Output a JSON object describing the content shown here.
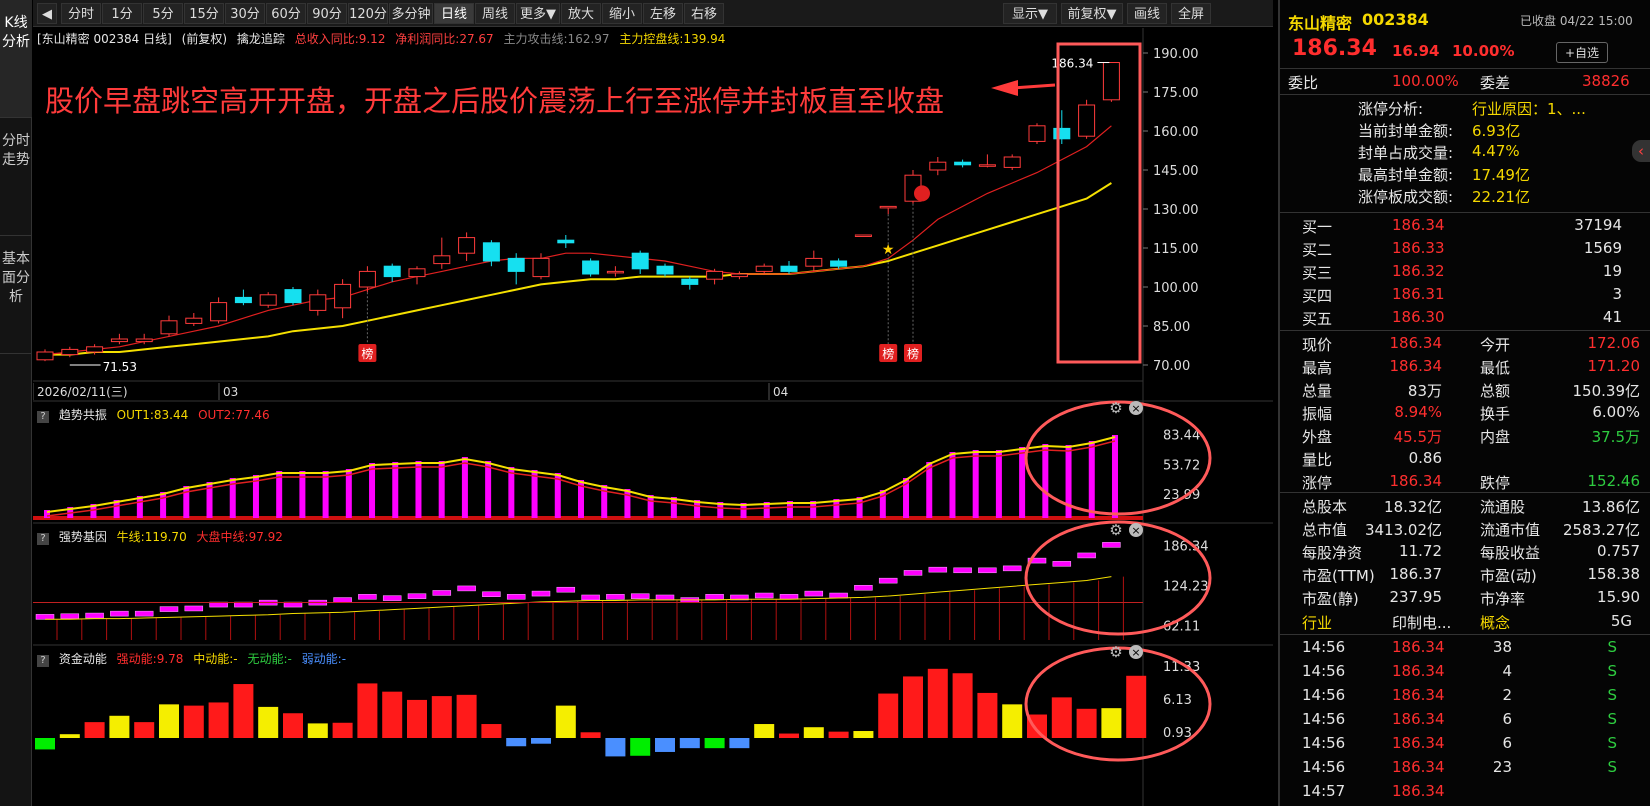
{
  "toolbar": {
    "back_icon": "collapse-left-icon",
    "buttons": [
      "分时",
      "1分",
      "5分",
      "15分",
      "30分",
      "60分",
      "90分",
      "120分",
      "多分钟",
      "日线",
      "周线",
      "更多▼",
      "放大",
      "缩小",
      "左移",
      "右移"
    ],
    "active": "日线",
    "right_buttons": [
      "显示▼",
      "前复权▼",
      "画线",
      "全屏"
    ]
  },
  "leftbar": {
    "tabs": [
      "K线分析",
      "分时走势",
      "基本面分析"
    ],
    "active": 0
  },
  "main": {
    "info": {
      "stock": "[东山精密 002384 日线]",
      "adj": "(前复权)",
      "indicator": "擒龙追踪",
      "rev": "总收入同比:9.12",
      "profit": "净利润同比:27.67",
      "attack": "主力攻击线:162.97",
      "control": "主力控盘线:139.94"
    },
    "annotation": "股价早盘跳空高开开盘，开盘之后股价震荡上行至涨停并封板直至收盘",
    "price_axis": [
      "190.00",
      "175.00",
      "160.00",
      "145.00",
      "130.00",
      "115.00",
      "100.00",
      "85.00",
      "70.00"
    ],
    "dates": [
      "2026/02/11(三)",
      "03",
      "04"
    ],
    "high_label": "186.34",
    "low_label": "71.53",
    "badge": "榜",
    "panel1": {
      "name": "趋势共振",
      "out1": "OUT1:83.44",
      "out2": "OUT2:77.46",
      "axis": [
        "83.44",
        "53.72",
        "23.99"
      ]
    },
    "panel2": {
      "name": "强势基因",
      "bull": "牛线:119.70",
      "mid": "大盘中线:97.92",
      "axis": [
        "186.34",
        "124.23",
        "62.11"
      ]
    },
    "panel3": {
      "name": "资金动能",
      "strong": "强动能:9.78",
      "medium": "中动能:-",
      "none": "无动能:-",
      "weak": "弱动能:-",
      "axis": [
        "11.33",
        "6.13",
        "0.93"
      ]
    }
  },
  "chart_data": {
    "type": "candlestick",
    "title": "",
    "ylim": [
      65,
      195
    ],
    "candles": [
      {
        "o": 72,
        "c": 75,
        "h": 76,
        "l": 71.5
      },
      {
        "o": 74,
        "c": 76,
        "h": 77,
        "l": 73
      },
      {
        "o": 75,
        "c": 77,
        "h": 78,
        "l": 74
      },
      {
        "o": 79,
        "c": 80,
        "h": 82,
        "l": 78
      },
      {
        "o": 79,
        "c": 80,
        "h": 82,
        "l": 78
      },
      {
        "o": 82,
        "c": 87,
        "h": 89,
        "l": 81
      },
      {
        "o": 86,
        "c": 88,
        "h": 90,
        "l": 85
      },
      {
        "o": 87,
        "c": 94,
        "h": 96,
        "l": 86
      },
      {
        "o": 96,
        "c": 94,
        "h": 99,
        "l": 93
      },
      {
        "o": 93,
        "c": 97,
        "h": 98,
        "l": 92
      },
      {
        "o": 99,
        "c": 94,
        "h": 100,
        "l": 93
      },
      {
        "o": 91,
        "c": 97,
        "h": 99,
        "l": 89
      },
      {
        "o": 92,
        "c": 101,
        "h": 103,
        "l": 88
      },
      {
        "o": 100,
        "c": 106,
        "h": 108,
        "l": 98
      },
      {
        "o": 108,
        "c": 104,
        "h": 109,
        "l": 102
      },
      {
        "o": 104,
        "c": 107,
        "h": 108,
        "l": 101
      },
      {
        "o": 109,
        "c": 112,
        "h": 119,
        "l": 107
      },
      {
        "o": 113,
        "c": 119,
        "h": 121,
        "l": 110
      },
      {
        "o": 117,
        "c": 110,
        "h": 118,
        "l": 108
      },
      {
        "o": 111,
        "c": 106,
        "h": 113,
        "l": 101
      },
      {
        "o": 104,
        "c": 111,
        "h": 113,
        "l": 103
      },
      {
        "o": 118,
        "c": 117,
        "h": 120,
        "l": 115
      },
      {
        "o": 110,
        "c": 105,
        "h": 111,
        "l": 104
      },
      {
        "o": 106,
        "c": 106,
        "h": 108,
        "l": 104
      },
      {
        "o": 113,
        "c": 107,
        "h": 114,
        "l": 105
      },
      {
        "o": 108,
        "c": 105,
        "h": 109,
        "l": 104
      },
      {
        "o": 103,
        "c": 101,
        "h": 104,
        "l": 99
      },
      {
        "o": 103,
        "c": 106,
        "h": 107,
        "l": 101
      },
      {
        "o": 104,
        "c": 105,
        "h": 106,
        "l": 103
      },
      {
        "o": 106,
        "c": 108,
        "h": 109,
        "l": 105
      },
      {
        "o": 108,
        "c": 106,
        "h": 110,
        "l": 105
      },
      {
        "o": 108,
        "c": 111,
        "h": 114,
        "l": 106
      },
      {
        "o": 110,
        "c": 108,
        "h": 111,
        "l": 107
      },
      {
        "o": 120,
        "c": 120,
        "h": 120,
        "l": 120
      },
      {
        "o": 131,
        "c": 131,
        "h": 131,
        "l": 128
      },
      {
        "o": 133,
        "c": 143,
        "h": 145,
        "l": 132
      },
      {
        "o": 145,
        "c": 148,
        "h": 150,
        "l": 143
      },
      {
        "o": 148,
        "c": 147,
        "h": 149,
        "l": 146
      },
      {
        "o": 147,
        "c": 147,
        "h": 151,
        "l": 146
      },
      {
        "o": 146,
        "c": 150,
        "h": 151,
        "l": 145
      },
      {
        "o": 156,
        "c": 162,
        "h": 163,
        "l": 155
      },
      {
        "o": 161,
        "c": 157,
        "h": 168,
        "l": 155
      },
      {
        "o": 158,
        "c": 170,
        "h": 172,
        "l": 157
      },
      {
        "o": 172,
        "c": 186.34,
        "h": 186.34,
        "l": 171.2
      }
    ],
    "ma_red": [
      74,
      75,
      76,
      77,
      79,
      81,
      83,
      85,
      88,
      91,
      93,
      95,
      96,
      99,
      102,
      104,
      106,
      108,
      110,
      111,
      111,
      113,
      113,
      112,
      111,
      110,
      108,
      106,
      105,
      105,
      105,
      106,
      107,
      108,
      111,
      118,
      126,
      131,
      136,
      140,
      144,
      149,
      154,
      162
    ],
    "ma_yellow": [
      74,
      74,
      75,
      75,
      76,
      77,
      78,
      79,
      80,
      81,
      83,
      84,
      85,
      87,
      89,
      91,
      93,
      95,
      97,
      99,
      101,
      102,
      103,
      103,
      104,
      104,
      104,
      104,
      105,
      105,
      105,
      106,
      107,
      108,
      110,
      113,
      116,
      119,
      122,
      125,
      128,
      131,
      134,
      140
    ],
    "panel1_bars": [
      8,
      11,
      14,
      18,
      22,
      26,
      32,
      36,
      40,
      43,
      47,
      47,
      47,
      49,
      55,
      56,
      57,
      57,
      61,
      57,
      51,
      48,
      45,
      38,
      33,
      29,
      23,
      21,
      18,
      16,
      15,
      16,
      17,
      17,
      19,
      21,
      28,
      40,
      56,
      66,
      68,
      68,
      71,
      74,
      73,
      77,
      83
    ],
    "panel3_bars": [
      -1.8,
      0.6,
      2.5,
      3.5,
      2.5,
      5.3,
      5.1,
      5.6,
      8.5,
      4.9,
      3.9,
      2.3,
      2.4,
      8.6,
      7.3,
      6,
      6.6,
      6.8,
      2.2,
      -1.3,
      -0.9,
      5.1,
      0.9,
      -2.9,
      -2.8,
      -2.2,
      -1.6,
      -1.6,
      -1.6,
      2.2,
      0.7,
      1.7,
      1,
      1.1,
      7,
      9.7,
      10.9,
      10.2,
      7.1,
      5.3,
      3.7,
      6.4,
      4.6,
      4.7,
      9.8
    ]
  },
  "rpanel": {
    "name": "东山精密",
    "code": "002384",
    "status": "已收盘 04/22 15:00",
    "price": "186.34",
    "change": "16.94",
    "pct": "10.00%",
    "fav_button": "+自选",
    "weibi_label": "委比",
    "weibi": "100.00%",
    "weicha_label": "委差",
    "weicha": "38826",
    "zt": [
      {
        "label": "涨停分析:",
        "value": "行业原因：1、..."
      },
      {
        "label": "当前封单金额:",
        "value": "6.93亿"
      },
      {
        "label": "封单占成交量:",
        "value": "4.47%"
      },
      {
        "label": "最高封单金额:",
        "value": "17.49亿"
      },
      {
        "label": "涨停板成交额:",
        "value": "22.21亿"
      }
    ],
    "bids": [
      {
        "label": "买一",
        "price": "186.34",
        "vol": "37194"
      },
      {
        "label": "买二",
        "price": "186.33",
        "vol": "1569"
      },
      {
        "label": "买三",
        "price": "186.32",
        "vol": "19"
      },
      {
        "label": "买四",
        "price": "186.31",
        "vol": "3"
      },
      {
        "label": "买五",
        "price": "186.30",
        "vol": "41"
      }
    ],
    "quote": [
      {
        "l1": "现价",
        "v1": "186.34",
        "c1": "red",
        "l2": "今开",
        "v2": "172.06",
        "c2": "red"
      },
      {
        "l1": "最高",
        "v1": "186.34",
        "c1": "red",
        "l2": "最低",
        "v2": "171.20",
        "c2": "red"
      },
      {
        "l1": "总量",
        "v1": "83万",
        "c1": "white",
        "l2": "总额",
        "v2": "150.39亿",
        "c2": "white"
      },
      {
        "l1": "振幅",
        "v1": "8.94%",
        "c1": "red",
        "l2": "换手",
        "v2": "6.00%",
        "c2": "white"
      },
      {
        "l1": "外盘",
        "v1": "45.5万",
        "c1": "red",
        "l2": "内盘",
        "v2": "37.5万",
        "c2": "green"
      },
      {
        "l1": "量比",
        "v1": "0.86",
        "c1": "white",
        "l2": "",
        "v2": "",
        "c2": "white"
      },
      {
        "l1": "涨停",
        "v1": "186.34",
        "c1": "red",
        "l2": "跌停",
        "v2": "152.46",
        "c2": "green"
      }
    ],
    "fund": [
      {
        "l1": "总股本",
        "v1": "18.32亿",
        "l2": "流通股",
        "v2": "13.86亿"
      },
      {
        "l1": "总市值",
        "v1": "3413.02亿",
        "l2": "流通市值",
        "v2": "2583.27亿"
      },
      {
        "l1": "每股净资",
        "v1": "11.72",
        "l2": "每股收益",
        "v2": "0.757"
      },
      {
        "l1": "市盈(TTM)",
        "v1": "186.37",
        "l2": "市盈(动)",
        "v2": "158.38"
      },
      {
        "l1": "市盈(静)",
        "v1": "237.95",
        "l2": "市净率",
        "v2": "15.90"
      }
    ],
    "industry_label": "行业",
    "industry": "印制电...",
    "concept_label": "概念",
    "concept": "5G",
    "ticks": [
      {
        "t": "14:56",
        "p": "186.34",
        "v": "38",
        "s": "S"
      },
      {
        "t": "14:56",
        "p": "186.34",
        "v": "4",
        "s": "S"
      },
      {
        "t": "14:56",
        "p": "186.34",
        "v": "2",
        "s": "S"
      },
      {
        "t": "14:56",
        "p": "186.34",
        "v": "6",
        "s": "S"
      },
      {
        "t": "14:56",
        "p": "186.34",
        "v": "6",
        "s": "S"
      },
      {
        "t": "14:56",
        "p": "186.34",
        "v": "23",
        "s": "S"
      },
      {
        "t": "14:57",
        "p": "186.34",
        "v": "",
        "s": ""
      }
    ]
  }
}
